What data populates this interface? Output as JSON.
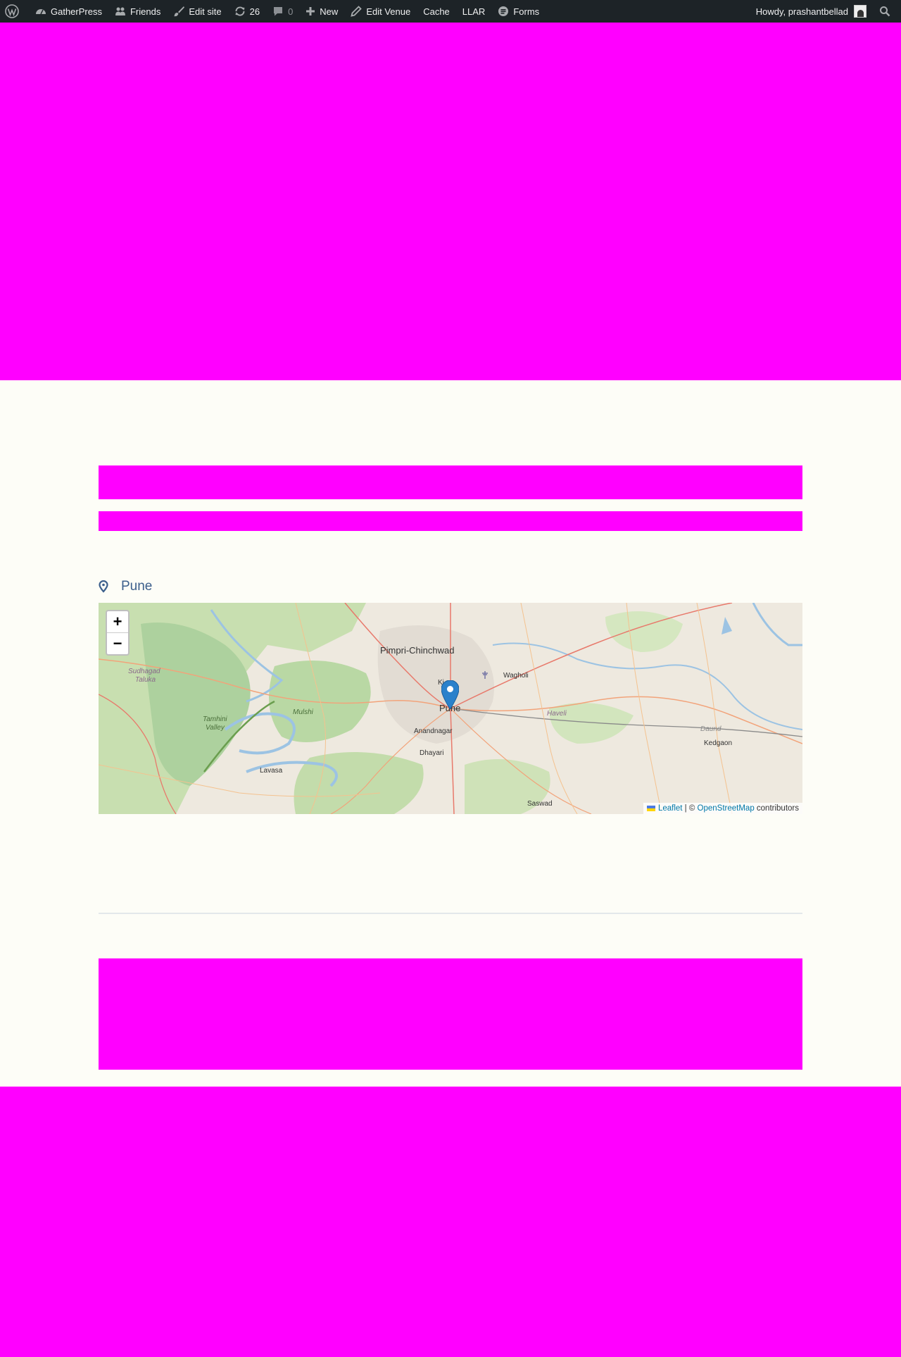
{
  "admin_bar": {
    "items": [
      {
        "icon": "wordpress-logo-icon",
        "label": ""
      },
      {
        "icon": "dashboard-icon",
        "label": "GatherPress"
      },
      {
        "icon": "friends-icon",
        "label": "Friends"
      },
      {
        "icon": "brush-icon",
        "label": "Edit site"
      },
      {
        "icon": "updates-icon",
        "label": "26"
      },
      {
        "icon": "comment-icon",
        "label": "0"
      },
      {
        "icon": "plus-icon",
        "label": "New"
      },
      {
        "icon": "pencil-icon",
        "label": "Edit Venue"
      },
      {
        "icon": "",
        "label": "Cache"
      },
      {
        "icon": "",
        "label": "LLAR"
      },
      {
        "icon": "forms-icon",
        "label": "Forms"
      }
    ],
    "howdy": "Howdy, prashantbellad"
  },
  "venue": {
    "icon": "location-pin-icon",
    "name": "Pune"
  },
  "map": {
    "zoom_in": "+",
    "zoom_out": "−",
    "marker_icon": "map-marker-icon",
    "labels": {
      "pimpri": "Pimpri-Chinchwad",
      "pune": "Pune",
      "wagholi": "Wagholi",
      "anandnagar": "Anandnagar",
      "dhayari": "Dhayari",
      "lavasa": "Lavasa",
      "mulshi": "Mulshi",
      "tamhini": "Tamhini",
      "valley": "Valley",
      "sudhagad": "Sudhagad",
      "taluka": "Taluka",
      "haveli": "Haveli",
      "daund": "Daund",
      "kedgaon": "Kedgaon",
      "saswad": "Saswad",
      "ki": "Ki"
    },
    "attribution": {
      "leaflet": "Leaflet",
      "separator": " | © ",
      "osm": "OpenStreetMap",
      "contributors": " contributors"
    }
  },
  "colors": {
    "admin_bar_bg": "#1d2327",
    "placeholder": "#ff00ff",
    "page_bg": "#fdfdf7",
    "venue_text": "#3c5f8c"
  }
}
